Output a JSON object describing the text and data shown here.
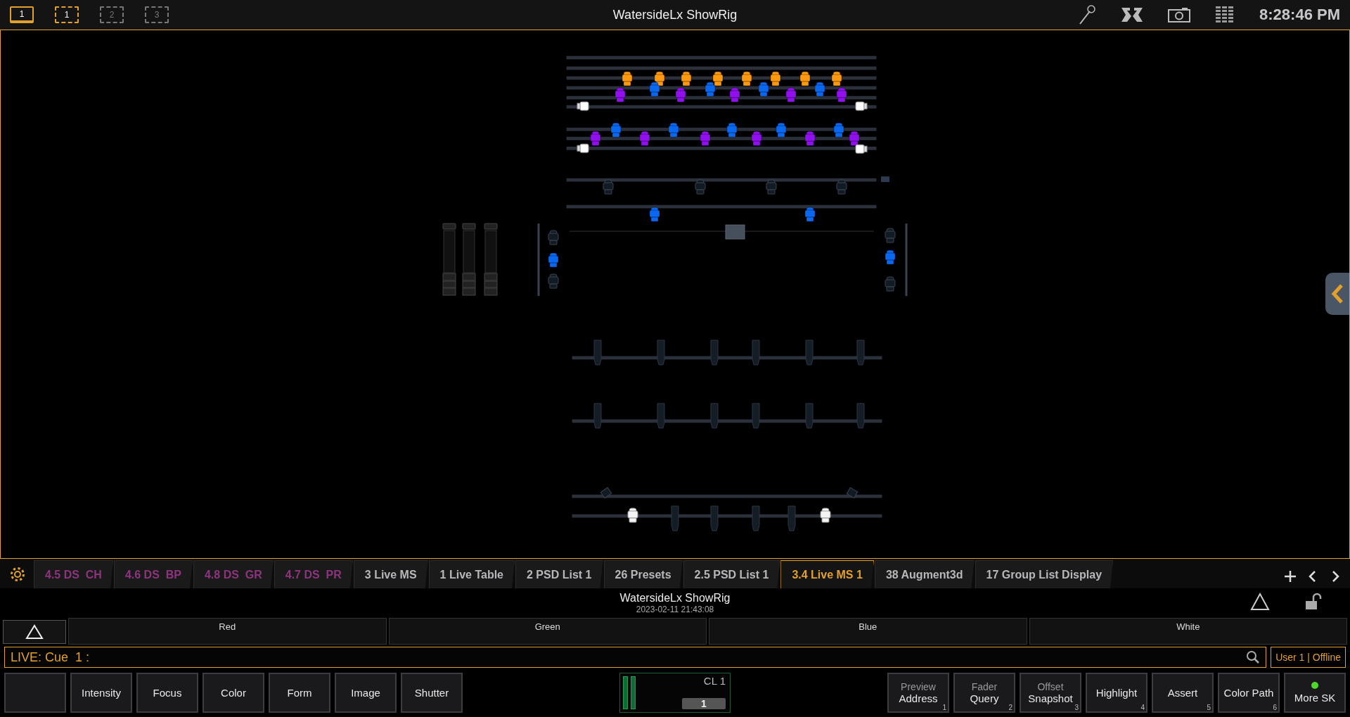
{
  "top_bar": {
    "display": {
      "label": "1",
      "selected": true
    },
    "workspaces": [
      {
        "label": "1",
        "selected": true
      },
      {
        "label": "2",
        "selected": false
      },
      {
        "label": "3",
        "selected": false
      }
    ],
    "title": "WatersideLx ShowRig",
    "time": "8:28:46 PM"
  },
  "tabs": [
    {
      "label": "4.5 DS  CH",
      "kind": "ds",
      "selected": false
    },
    {
      "label": "4.6 DS  BP",
      "kind": "ds",
      "selected": false
    },
    {
      "label": "4.8 DS  GR",
      "kind": "ds",
      "selected": false
    },
    {
      "label": "4.7 DS  PR",
      "kind": "ds",
      "selected": false
    },
    {
      "label": "3 Live MS",
      "kind": "view",
      "selected": false
    },
    {
      "label": "1 Live Table",
      "kind": "view",
      "selected": false
    },
    {
      "label": "2 PSD List 1",
      "kind": "view",
      "selected": false
    },
    {
      "label": "26 Presets",
      "kind": "view",
      "selected": false
    },
    {
      "label": "2.5 PSD List 1",
      "kind": "view",
      "selected": false
    },
    {
      "label": "3.4 Live MS 1",
      "kind": "view",
      "selected": true
    },
    {
      "label": "38 Augment3d",
      "kind": "view",
      "selected": false
    },
    {
      "label": "17 Group List Display",
      "kind": "view",
      "selected": false
    }
  ],
  "show": {
    "title": "WatersideLx ShowRig",
    "date": "2023-02-11 21:43:08",
    "locked": false
  },
  "color_columns": [
    "Red",
    "Green",
    "Blue",
    "White"
  ],
  "command_line": {
    "text": "LIVE: Cue  1 :",
    "user": "User 1 | Offline"
  },
  "softkeys_left": [
    {
      "kind": "blank"
    },
    {
      "kind": "key",
      "label": "Intensity"
    },
    {
      "kind": "key",
      "label": "Focus"
    },
    {
      "kind": "key",
      "label": "Color"
    },
    {
      "kind": "key",
      "label": "Form"
    },
    {
      "kind": "key",
      "label": "Image"
    },
    {
      "kind": "key",
      "label": "Shutter"
    }
  ],
  "cue_list": {
    "label": "CL 1",
    "value": "1"
  },
  "softkeys_right": [
    {
      "top": "Preview",
      "label": "Address",
      "number": "1"
    },
    {
      "top": "Fader",
      "label": "Query",
      "number": "2"
    },
    {
      "top": "Offset",
      "label": "Snapshot",
      "number": "3"
    },
    {
      "label": "Highlight",
      "number": "4"
    },
    {
      "label": "Assert",
      "number": "5"
    },
    {
      "label": "Color Path",
      "number": "6"
    },
    {
      "label": "More SK",
      "indicator_on": true
    }
  ]
}
